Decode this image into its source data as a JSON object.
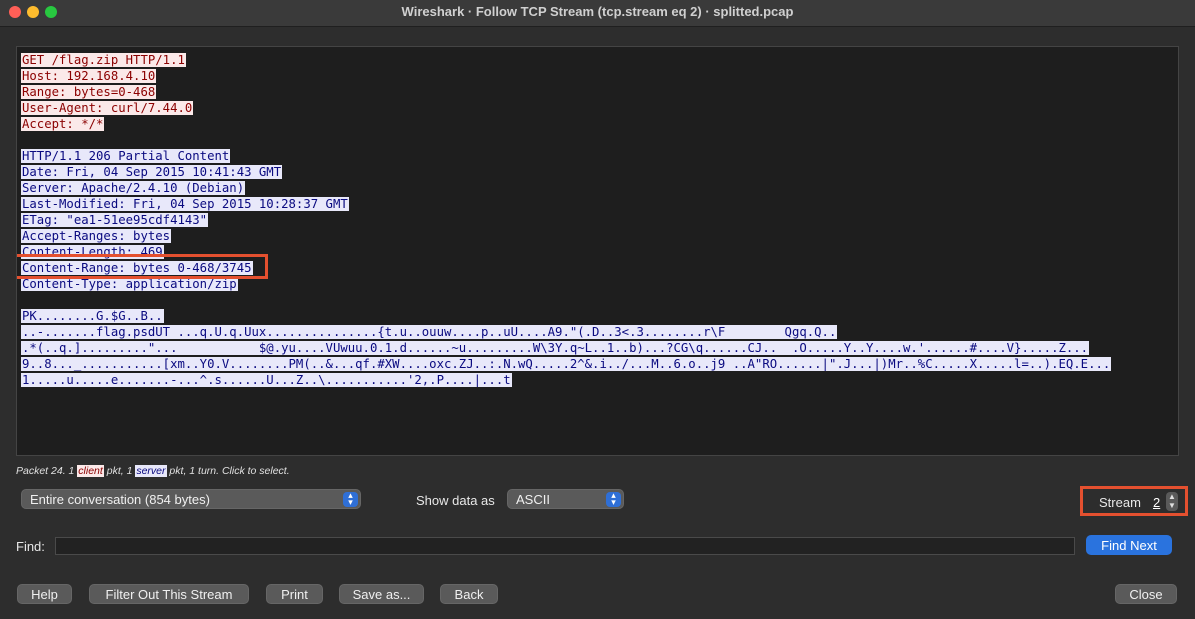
{
  "window": {
    "title": "Wireshark · Follow TCP Stream (tcp.stream eq 2) · splitted.pcap"
  },
  "stream": {
    "client_lines": [
      "GET /flag.zip HTTP/1.1",
      "Host: 192.168.4.10",
      "Range: bytes=0-468",
      "User-Agent: curl/7.44.0",
      "Accept: */*"
    ],
    "server_lines": [
      "HTTP/1.1 206 Partial Content",
      "Date: Fri, 04 Sep 2015 10:41:43 GMT",
      "Server: Apache/2.4.10 (Debian)",
      "Last-Modified: Fri, 04 Sep 2015 10:28:37 GMT",
      "ETag: \"ea1-51ee95cdf4143\"",
      "Accept-Ranges: bytes",
      "Content-Length: 469",
      "Content-Range: bytes 0-468/3745",
      "Content-Type: application/zip"
    ],
    "payload_lines": [
      "PK........G.$G..B..",
      "..-.......flag.psdUT ...q.U.q.Uux...............{t.u..ouuw....p..uU....A9.\"(.D..3<.3........r\\F        Qgq.Q..",
      ".*(..q.].........\"...           $@.yu....VUwuu.0.1.d......~u.........W\\3Y.q~L..1..b)...?CG\\q......CJ..  .O.....Y..Y....w.'......#....V}.....Z...",
      "9..8..._...........[xm..Y0.V........PM(..&...qf.#XW....oxc.ZJ..:.N.wQ.....2^&.i../...M..6.o..j9 ..A\"RO......|\".J...|)Mr..%C.....X.....l=..).EQ.E...",
      "1.....u.....e.......-...^.s......U...Z..\\...........'2,.P....|...t"
    ]
  },
  "packet_info": {
    "prefix": "Packet 24. 1 ",
    "client_word": "client",
    "middle": " pkt, 1 ",
    "server_word": "server",
    "suffix": " pkt, 1 turn. Click to select."
  },
  "controls": {
    "conversation_select": "Entire conversation (854 bytes)",
    "show_data_label": "Show data as",
    "show_data_select": "ASCII",
    "stream_label": "Stream",
    "stream_value": "2",
    "find_label": "Find:",
    "find_value": "",
    "find_next": "Find Next"
  },
  "buttons": {
    "help": "Help",
    "filter_out": "Filter Out This Stream",
    "print": "Print",
    "save_as": "Save as...",
    "back": "Back",
    "close": "Close"
  }
}
